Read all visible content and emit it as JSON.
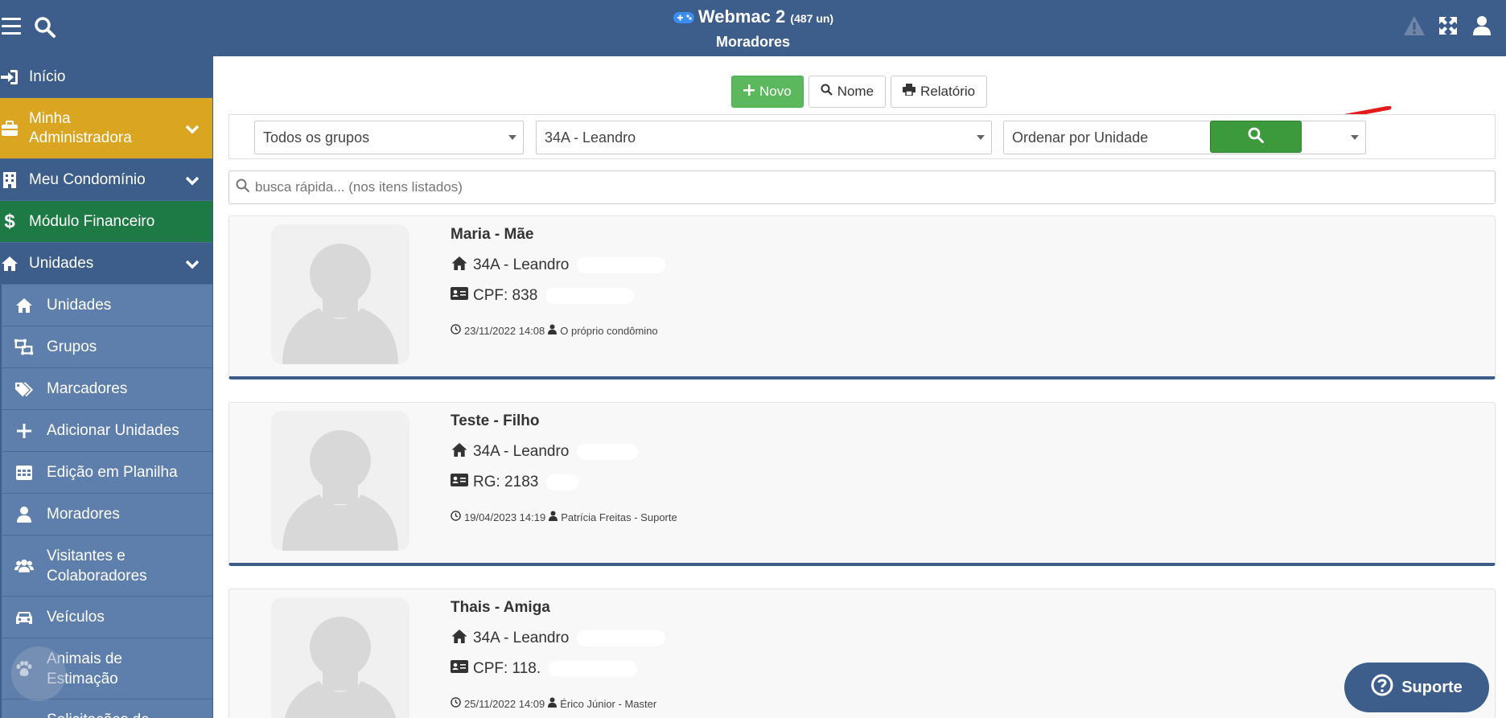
{
  "header": {
    "app_title": "Webmac 2",
    "unit_count": "(487 un)",
    "page_title": "Moradores"
  },
  "sidebar": {
    "items": [
      {
        "label": "Início"
      },
      {
        "label": "Minha Administradora"
      },
      {
        "label": "Meu Condomínio"
      },
      {
        "label": "Módulo Financeiro"
      },
      {
        "label": "Unidades"
      }
    ],
    "sub_items": [
      {
        "label": "Unidades"
      },
      {
        "label": "Grupos"
      },
      {
        "label": "Marcadores"
      },
      {
        "label": "Adicionar Unidades"
      },
      {
        "label": "Edição em Planilha"
      },
      {
        "label": "Moradores"
      },
      {
        "label": "Visitantes e Colaboradores"
      },
      {
        "label": "Veículos"
      },
      {
        "label": "Animais de Estimação"
      },
      {
        "label": "Solicitações de"
      }
    ]
  },
  "toolbar": {
    "new_label": "Novo",
    "name_label": "Nome",
    "report_label": "Relatório"
  },
  "filters": {
    "group": "Todos os grupos",
    "unit": "34A - Leandro",
    "order": "Ordenar por Unidade"
  },
  "search": {
    "placeholder": "busca rápida... (nos itens listados)"
  },
  "residents": [
    {
      "name": "Maria - Mãe",
      "unit": "34A - Leandro",
      "doc": "CPF: 838",
      "date": "23/11/2022 14:08",
      "user": "O próprio condômino"
    },
    {
      "name": "Teste - Filho",
      "unit": "34A - Leandro",
      "doc": "RG: 2183",
      "date": "19/04/2023 14:19",
      "user": "Patrícia Freitas - Suporte"
    },
    {
      "name": "Thais - Amiga",
      "unit": "34A - Leandro",
      "doc": "CPF: 118.",
      "date": "25/11/2022 14:09",
      "user": "Érico Júnior - Master"
    }
  ],
  "support": {
    "label": "Suporte"
  },
  "colors": {
    "primary": "#3d5e8b",
    "admin": "#daa520",
    "finance": "#1e7a44",
    "success": "#5cb85c",
    "annotation_arrow": "#e51b1b"
  }
}
